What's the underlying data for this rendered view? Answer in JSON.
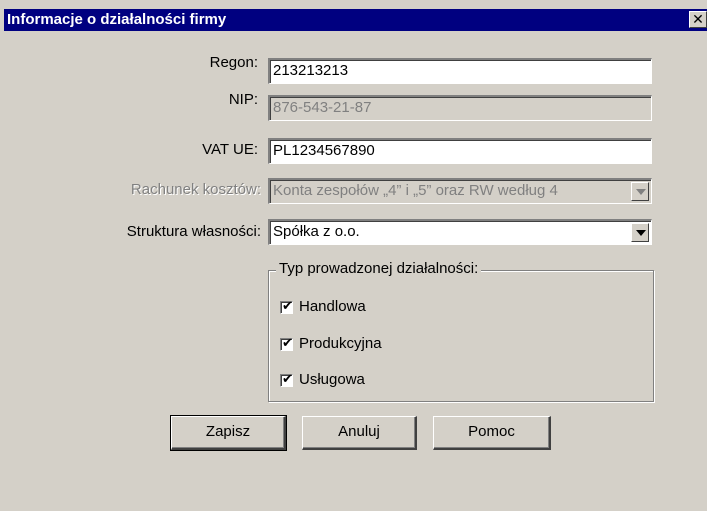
{
  "window": {
    "title": "Informacje o działalności firmy",
    "close_glyph": "✕"
  },
  "form": {
    "regon_label": "Regon:",
    "regon_value": "213213213",
    "nip_label": "NIP:",
    "nip_value": "876-543-21-87",
    "vat_label": "VAT UE:",
    "vat_value": "PL1234567890",
    "rachunek_label": "Rachunek kosztów:",
    "rachunek_value": "Konta zespołów „4” i „5” oraz RW według 4",
    "struktura_label": "Struktura własności:",
    "struktura_value": "Spółka z o.o."
  },
  "group": {
    "title": "Typ prowadzonej działalności:",
    "items": [
      {
        "label": "Handlowa",
        "checked": true
      },
      {
        "label": "Produkcyjna",
        "checked": true
      },
      {
        "label": "Usługowa",
        "checked": true
      }
    ]
  },
  "buttons": {
    "save": "Zapisz",
    "cancel": "Anuluj",
    "help": "Pomoc"
  },
  "icons": {
    "check": "✔"
  }
}
